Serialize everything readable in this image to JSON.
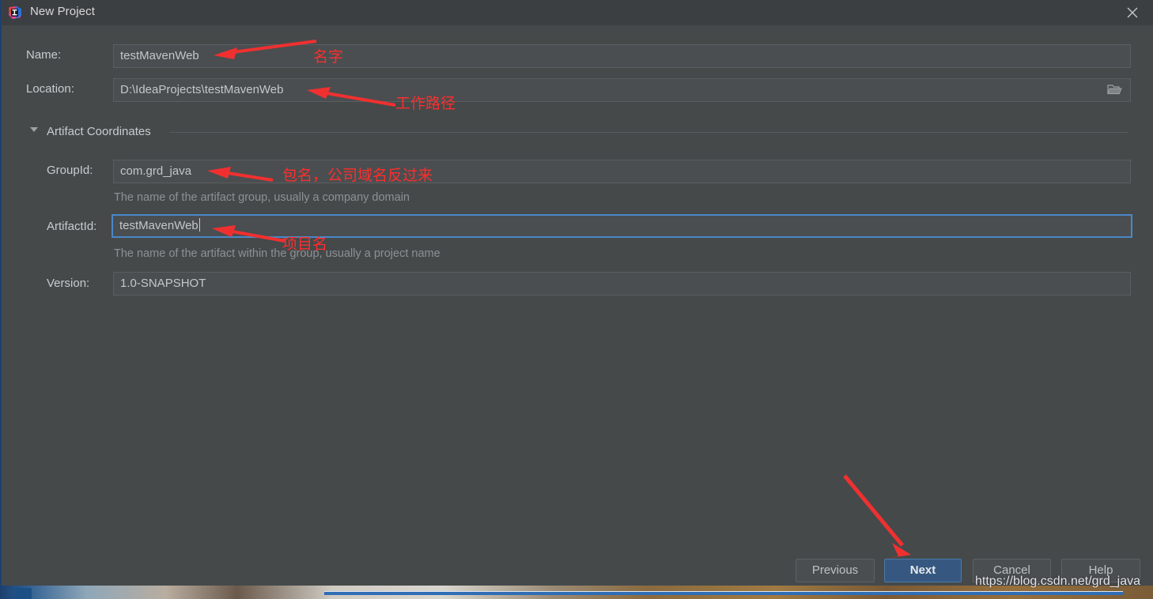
{
  "window": {
    "title": "New Project",
    "app_icon": "intellij-idea-icon",
    "close_icon": "close-icon"
  },
  "form": {
    "name": {
      "label": "Name:",
      "value": "testMavenWeb"
    },
    "location": {
      "label": "Location:",
      "value": "D:\\IdeaProjects\\testMavenWeb",
      "browse_icon": "folder-open-icon"
    },
    "section": {
      "label": "Artifact Coordinates",
      "expanded": true,
      "collapse_icon": "chevron-down-icon"
    },
    "group_id": {
      "label": "GroupId:",
      "value": "com.grd_java",
      "hint": "The name of the artifact group, usually a company domain"
    },
    "artifact_id": {
      "label": "ArtifactId:",
      "value": "testMavenWeb",
      "hint": "The name of the artifact within the group, usually a project name",
      "focused": true
    },
    "version": {
      "label": "Version:",
      "value": "1.0-SNAPSHOT"
    }
  },
  "footer": {
    "previous_label": "Previous",
    "next_label": "Next",
    "cancel_label": "Cancel",
    "help_label": "Help"
  },
  "annotations": [
    {
      "id": "name-annot",
      "text": "名字"
    },
    {
      "id": "location-annot",
      "text": "工作路径"
    },
    {
      "id": "groupid-annot",
      "text": "包名，公司域名反过来"
    },
    {
      "id": "artifactid-annot",
      "text": "项目名"
    }
  ],
  "watermark": "https://blog.csdn.net/grd_java",
  "colors": {
    "dialog_background": "#45494a",
    "titlebar_background": "#3c3f41",
    "field_background": "#4a4e50",
    "focus_border": "#4a88c7",
    "primary_button": "#365880",
    "annotation_red": "#ff2d2d",
    "label_text": "#c9ccce",
    "hint_text": "#8d9194"
  }
}
